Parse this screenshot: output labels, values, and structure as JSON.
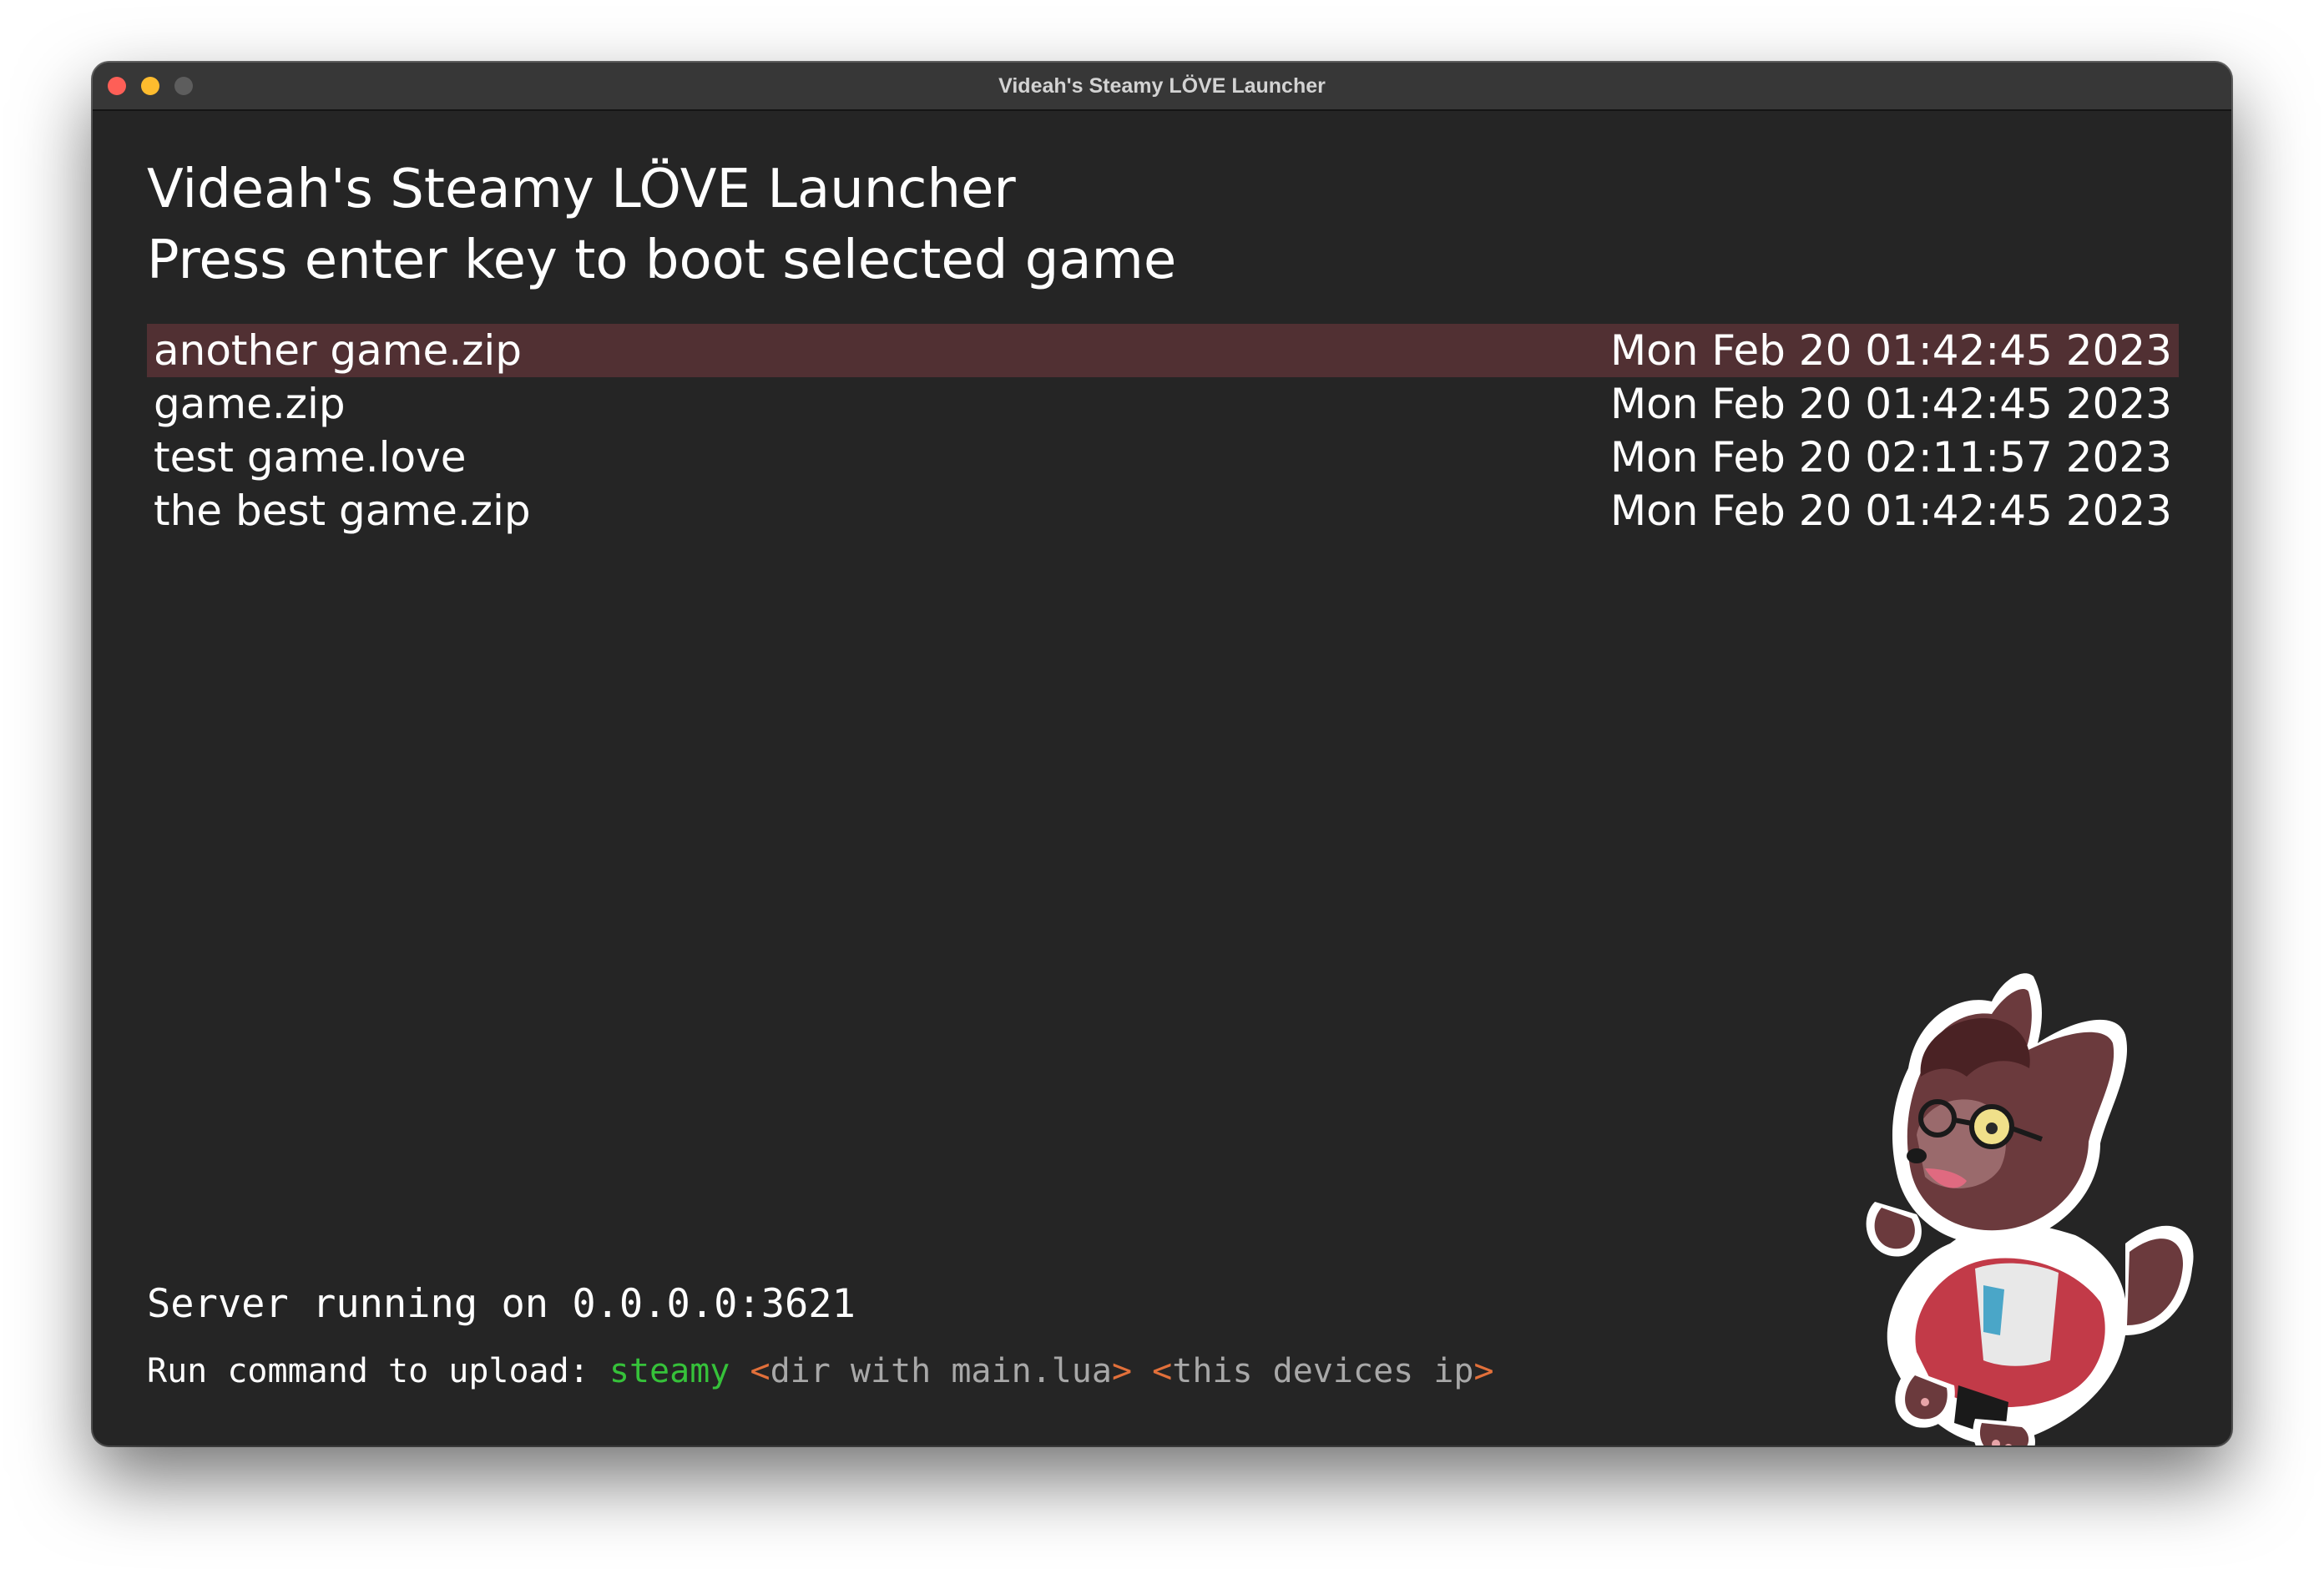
{
  "window": {
    "title": "Videah's Steamy LÖVE Launcher"
  },
  "header": {
    "title": "Videah's Steamy LÖVE Launcher",
    "instruction": "Press enter key to boot selected game"
  },
  "games": [
    {
      "name": "another game.zip",
      "date": "Mon Feb 20 01:42:45 2023",
      "selected": true
    },
    {
      "name": "game.zip",
      "date": "Mon Feb 20 01:42:45 2023",
      "selected": false
    },
    {
      "name": "test game.love",
      "date": "Mon Feb 20 02:11:57 2023",
      "selected": false
    },
    {
      "name": "the best game.zip",
      "date": "Mon Feb 20 01:42:45 2023",
      "selected": false
    }
  ],
  "footer": {
    "server_status": "Server running on 0.0.0.0:3621",
    "upload_prefix": "Run command to upload: ",
    "upload_command": "steamy",
    "arg1_open": "<",
    "arg1": "dir with main.lua",
    "arg1_close": ">",
    "arg2_open": "<",
    "arg2": "this devices ip",
    "arg2_close": ">"
  },
  "colors": {
    "background": "#252525",
    "selected_row": "#513033",
    "command_green": "#36c23a",
    "bracket_orange": "#e2703a",
    "placeholder_gray": "#a8a8a8"
  },
  "icons": {
    "mascot": "wolf-mascot-sticker"
  }
}
